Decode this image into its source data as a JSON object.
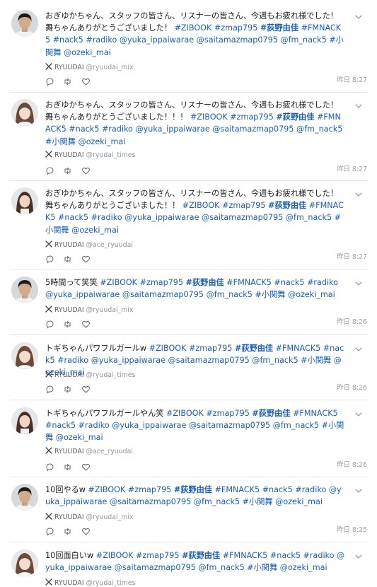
{
  "icons": {
    "source": "x-logo-icon",
    "reply": "reply-icon",
    "repost": "repost-icon",
    "like": "heart-icon",
    "menu": "chevron-down-icon"
  },
  "colors": {
    "hashtag": "#1a5fb4",
    "text": "#202124",
    "meta": "#9aa0a6",
    "divider": "#e3e5e8"
  },
  "posts": [
    {
      "avatar": "man",
      "segments": [
        {
          "t": "おぎゆかちゃん、スタッフの皆さん、リスナーの皆さん、今週もお疲れ様でした！舞ちゃんありがとうございました！ "
        },
        {
          "t": "#ZIBOOK",
          "tag": true
        },
        {
          "t": " "
        },
        {
          "t": "#zmap795",
          "tag": true
        },
        {
          "t": " "
        },
        {
          "t": "#荻野由佳",
          "tag": true,
          "bold": true
        },
        {
          "t": " "
        },
        {
          "t": "#FMNACK5",
          "tag": true
        },
        {
          "t": " "
        },
        {
          "t": "#nack5",
          "tag": true
        },
        {
          "t": " "
        },
        {
          "t": "#radiko",
          "tag": true
        },
        {
          "t": " "
        },
        {
          "t": "@yuka_ippaiwarae",
          "tag": true
        },
        {
          "t": " "
        },
        {
          "t": "@saitamazmap0795",
          "tag": true
        },
        {
          "t": " "
        },
        {
          "t": "@fm_nack5",
          "tag": true
        },
        {
          "t": " "
        },
        {
          "t": "#小関舞",
          "tag": true
        },
        {
          "t": " "
        },
        {
          "t": "@ozeki_mai",
          "tag": true
        }
      ],
      "source_name": "RYUUDAI",
      "source_handle": "@ryuudai_mix",
      "time": "昨日 8:27"
    },
    {
      "avatar": "woman",
      "segments": [
        {
          "t": "おぎゆかちゃん、スタッフの皆さん、リスナーの皆さん、今週もお疲れ様でした！舞ちゃんありがとうございました！！！ "
        },
        {
          "t": "#ZIBOOK",
          "tag": true
        },
        {
          "t": " "
        },
        {
          "t": "#zmap795",
          "tag": true
        },
        {
          "t": " "
        },
        {
          "t": "#荻野由佳",
          "tag": true,
          "bold": true
        },
        {
          "t": " "
        },
        {
          "t": "#FMNACK5",
          "tag": true
        },
        {
          "t": " "
        },
        {
          "t": "#nack5",
          "tag": true
        },
        {
          "t": " "
        },
        {
          "t": "#radiko",
          "tag": true
        },
        {
          "t": " "
        },
        {
          "t": "@yuka_ippaiwarae",
          "tag": true
        },
        {
          "t": " "
        },
        {
          "t": "@saitamazmap0795",
          "tag": true
        },
        {
          "t": " "
        },
        {
          "t": "@fm_nack5",
          "tag": true
        },
        {
          "t": " "
        },
        {
          "t": "#小関舞",
          "tag": true
        },
        {
          "t": " "
        },
        {
          "t": "@ozeki_mai",
          "tag": true
        }
      ],
      "source_name": "RYUUDAI",
      "source_handle": "@ryudai_times",
      "time": "昨日 8:27"
    },
    {
      "avatar": "woman2",
      "segments": [
        {
          "t": "おぎゆかちゃん、スタッフの皆さん、リスナーの皆さん、今週もお疲れ様でした！舞ちゃんありがとうございました！！ "
        },
        {
          "t": "#ZIBOOK",
          "tag": true
        },
        {
          "t": " "
        },
        {
          "t": "#zmap795",
          "tag": true
        },
        {
          "t": " "
        },
        {
          "t": "#荻野由佳",
          "tag": true,
          "bold": true
        },
        {
          "t": " "
        },
        {
          "t": "#FMNACK5",
          "tag": true
        },
        {
          "t": " "
        },
        {
          "t": "#nack5",
          "tag": true
        },
        {
          "t": " "
        },
        {
          "t": "#radiko",
          "tag": true
        },
        {
          "t": " "
        },
        {
          "t": "@yuka_ippaiwarae",
          "tag": true
        },
        {
          "t": " "
        },
        {
          "t": "@saitamazmap0795",
          "tag": true
        },
        {
          "t": " "
        },
        {
          "t": "@fm_nack5",
          "tag": true
        },
        {
          "t": " "
        },
        {
          "t": "#小関舞",
          "tag": true
        },
        {
          "t": " "
        },
        {
          "t": "@ozeki_mai",
          "tag": true
        }
      ],
      "source_name": "RYUUDAI",
      "source_handle": "@ace_ryuudai",
      "time": "昨日 8:27"
    },
    {
      "avatar": "man",
      "segments": [
        {
          "t": "5時間って笑笑 "
        },
        {
          "t": "#ZIBOOK",
          "tag": true
        },
        {
          "t": " "
        },
        {
          "t": "#zmap795",
          "tag": true
        },
        {
          "t": " "
        },
        {
          "t": "#荻野由佳",
          "tag": true,
          "bold": true
        },
        {
          "t": " "
        },
        {
          "t": "#FMNACK5",
          "tag": true
        },
        {
          "t": " "
        },
        {
          "t": "#nack5",
          "tag": true
        },
        {
          "t": " "
        },
        {
          "t": "#radiko",
          "tag": true
        },
        {
          "t": " "
        },
        {
          "t": "@yuka_ippaiwarae",
          "tag": true
        },
        {
          "t": " "
        },
        {
          "t": "@saitamazmap0795",
          "tag": true
        },
        {
          "t": " "
        },
        {
          "t": "@fm_nack5",
          "tag": true
        },
        {
          "t": " "
        },
        {
          "t": "#小関舞",
          "tag": true
        },
        {
          "t": " "
        },
        {
          "t": "@ozeki_mai",
          "tag": true
        }
      ],
      "source_name": "RYUUDAI",
      "source_handle": "@ryuudai_mix",
      "time": "昨日 8:26"
    },
    {
      "avatar": "woman",
      "segments": [
        {
          "t": "トギちゃんパワフルガールw "
        },
        {
          "t": "#ZIBOOK",
          "tag": true
        },
        {
          "t": " "
        },
        {
          "t": "#zmap795",
          "tag": true
        },
        {
          "t": " "
        },
        {
          "t": "#荻野由佳",
          "tag": true,
          "bold": true
        },
        {
          "t": " "
        },
        {
          "t": "#FMNACK5",
          "tag": true
        },
        {
          "t": " "
        },
        {
          "t": "#nack5",
          "tag": true
        },
        {
          "t": " "
        },
        {
          "t": "#radiko",
          "tag": true
        },
        {
          "t": " "
        },
        {
          "t": "@yuka_ippaiwarae",
          "tag": true
        },
        {
          "t": " "
        },
        {
          "t": "@saitamazmap0795",
          "tag": true
        },
        {
          "t": " "
        },
        {
          "t": "@fm_nack5",
          "tag": true
        },
        {
          "t": " "
        },
        {
          "t": "#小関舞",
          "tag": true
        },
        {
          "t": " "
        },
        {
          "t": "@ozeki_mai",
          "tag": true
        }
      ],
      "source_name": "RYUUDAI",
      "source_handle": "@ryudai_times",
      "time": "昨日 8:26"
    },
    {
      "avatar": "woman2",
      "segments": [
        {
          "t": "トギちゃんパワフルガールやん笑 "
        },
        {
          "t": "#ZIBOOK",
          "tag": true
        },
        {
          "t": " "
        },
        {
          "t": "#zmap795",
          "tag": true
        },
        {
          "t": " "
        },
        {
          "t": "#荻野由佳",
          "tag": true,
          "bold": true
        },
        {
          "t": " "
        },
        {
          "t": "#FMNACK5",
          "tag": true
        },
        {
          "t": " "
        },
        {
          "t": "#nack5",
          "tag": true
        },
        {
          "t": " "
        },
        {
          "t": "#radiko",
          "tag": true
        },
        {
          "t": " "
        },
        {
          "t": "@yuka_ippaiwarae",
          "tag": true
        },
        {
          "t": " "
        },
        {
          "t": "@saitamazmap0795",
          "tag": true
        },
        {
          "t": " "
        },
        {
          "t": "@fm_nack5",
          "tag": true
        },
        {
          "t": " "
        },
        {
          "t": "#小関舞",
          "tag": true
        },
        {
          "t": " "
        },
        {
          "t": "@ozeki_mai",
          "tag": true
        }
      ],
      "source_name": "RYUUDAI",
      "source_handle": "@ace_ryuudai",
      "time": "昨日 8:26"
    },
    {
      "avatar": "man",
      "segments": [
        {
          "t": "10回やるw "
        },
        {
          "t": "#ZIBOOK",
          "tag": true
        },
        {
          "t": " "
        },
        {
          "t": "#zmap795",
          "tag": true
        },
        {
          "t": " "
        },
        {
          "t": "#荻野由佳",
          "tag": true,
          "bold": true
        },
        {
          "t": " "
        },
        {
          "t": "#FMNACK5",
          "tag": true
        },
        {
          "t": " "
        },
        {
          "t": "#nack5",
          "tag": true
        },
        {
          "t": " "
        },
        {
          "t": "#radiko",
          "tag": true
        },
        {
          "t": " "
        },
        {
          "t": "@yuka_ippaiwarae",
          "tag": true
        },
        {
          "t": " "
        },
        {
          "t": "@saitamazmap0795",
          "tag": true
        },
        {
          "t": " "
        },
        {
          "t": "@fm_nack5",
          "tag": true
        },
        {
          "t": " "
        },
        {
          "t": "#小関舞",
          "tag": true
        },
        {
          "t": " "
        },
        {
          "t": "@ozeki_mai",
          "tag": true
        }
      ],
      "source_name": "RYUUDAI",
      "source_handle": "@ryuudai_mix",
      "time": "昨日 8:25"
    },
    {
      "avatar": "woman",
      "segments": [
        {
          "t": "10回面白いw "
        },
        {
          "t": "#ZIBOOK",
          "tag": true
        },
        {
          "t": " "
        },
        {
          "t": "#zmap795",
          "tag": true
        },
        {
          "t": " "
        },
        {
          "t": "#荻野由佳",
          "tag": true,
          "bold": true
        },
        {
          "t": " "
        },
        {
          "t": "#FMNACK5",
          "tag": true
        },
        {
          "t": " "
        },
        {
          "t": "#nack5",
          "tag": true
        },
        {
          "t": " "
        },
        {
          "t": "#radiko",
          "tag": true
        },
        {
          "t": " "
        },
        {
          "t": "@yuka_ippaiwarae",
          "tag": true
        },
        {
          "t": " "
        },
        {
          "t": "@saitamazmap0795",
          "tag": true
        },
        {
          "t": " "
        },
        {
          "t": "@fm_nack5",
          "tag": true
        },
        {
          "t": " "
        },
        {
          "t": "#小関舞",
          "tag": true
        },
        {
          "t": " "
        },
        {
          "t": "@ozeki_mai",
          "tag": true
        }
      ],
      "source_name": "RYUUDAI",
      "source_handle": "@ryudai_times",
      "time": ""
    }
  ]
}
